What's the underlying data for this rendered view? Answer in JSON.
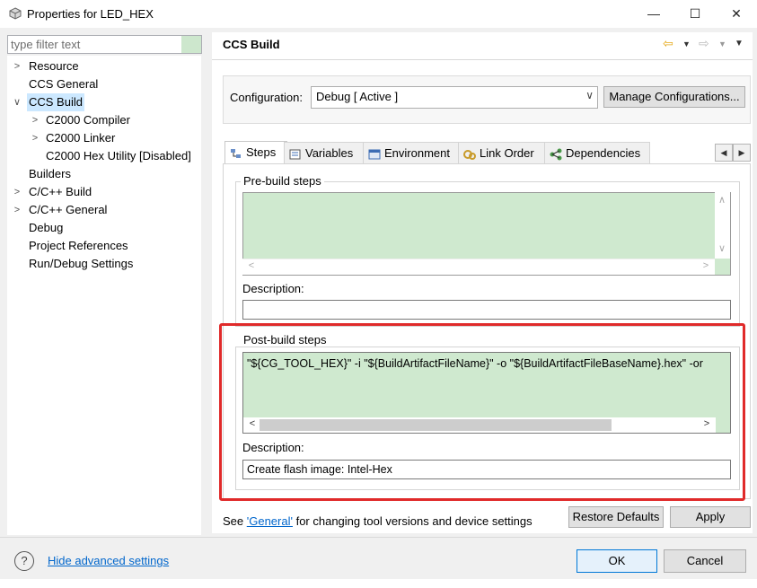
{
  "window": {
    "title": "Properties for LED_HEX",
    "minimize_glyph": "—",
    "maximize_glyph": "☐",
    "close_glyph": "✕"
  },
  "filter": {
    "placeholder": "type filter text"
  },
  "tree": {
    "items": [
      {
        "label": "Resource",
        "expandable": true
      },
      {
        "label": "CCS General",
        "expandable": false
      },
      {
        "label": "CCS Build",
        "expandable": true,
        "expanded": true,
        "selected": true
      },
      {
        "label": "C2000 Compiler",
        "expandable": true,
        "indent": 1
      },
      {
        "label": "C2000 Linker",
        "expandable": true,
        "indent": 1
      },
      {
        "label": "C2000 Hex Utility  [Disabled]",
        "expandable": false,
        "indent": 1
      },
      {
        "label": "Builders",
        "expandable": false
      },
      {
        "label": "C/C++ Build",
        "expandable": true
      },
      {
        "label": "C/C++ General",
        "expandable": true
      },
      {
        "label": "Debug",
        "expandable": false
      },
      {
        "label": "Project References",
        "expandable": false
      },
      {
        "label": "Run/Debug Settings",
        "expandable": false
      }
    ]
  },
  "panel": {
    "title": "CCS Build",
    "configuration_label": "Configuration:",
    "configuration_value": "Debug  [ Active ]",
    "manage_button": "Manage Configurations...",
    "tabs": [
      {
        "label": "Steps",
        "icon": "steps-icon",
        "active": true
      },
      {
        "label": "Variables",
        "icon": "variables-icon"
      },
      {
        "label": "Environment",
        "icon": "environment-icon"
      },
      {
        "label": "Link Order",
        "icon": "link-order-icon"
      },
      {
        "label": "Dependencies",
        "icon": "dependencies-icon"
      }
    ],
    "pre_build": {
      "legend": "Pre-build steps",
      "steps": "",
      "description_label": "Description:",
      "description": ""
    },
    "post_build": {
      "legend": "Post-build steps",
      "steps": "\"${CG_TOOL_HEX}\" -i \"${BuildArtifactFileName}\" -o \"${BuildArtifactFileBaseName}.hex\" -or",
      "description_label": "Description:",
      "description": "Create flash image: Intel-Hex"
    },
    "footer_prefix": "See ",
    "footer_link": "'General'",
    "footer_suffix": " for changing tool versions and device settings",
    "restore_defaults": "Restore Defaults",
    "apply": "Apply"
  },
  "bottom": {
    "hide_advanced": "Hide advanced settings",
    "ok": "OK",
    "cancel": "Cancel"
  },
  "colors": {
    "selection": "#cce8ff",
    "field_green": "#cfe9cf",
    "highlight_red": "#e02a2a",
    "link_blue": "#0066cc"
  }
}
